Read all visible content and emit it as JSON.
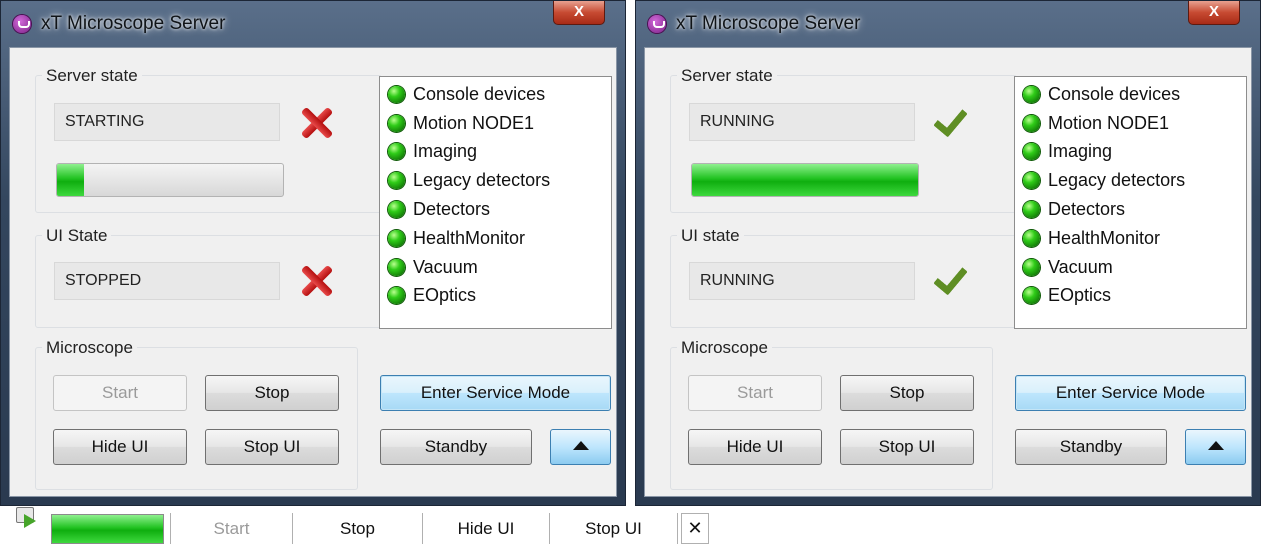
{
  "windows": [
    {
      "title": "xT Microscope Server",
      "close_glyph": "X",
      "server_state": {
        "label": "Server state",
        "value": "STARTING",
        "status_icon": "red-x-icon",
        "progress": 0.12
      },
      "ui_state": {
        "label": "UI State",
        "value": "STOPPED",
        "status_icon": "red-x-icon"
      },
      "modules": [
        "Console devices",
        "Motion NODE1",
        "Imaging",
        "Legacy detectors",
        "Detectors",
        "HealthMonitor",
        "Vacuum",
        "EOptics"
      ],
      "microscope": {
        "label": "Microscope",
        "start": "Start",
        "stop": "Stop",
        "hide_ui": "Hide UI",
        "stop_ui": "Stop UI"
      },
      "service_mode": "Enter Service Mode",
      "standby": "Standby"
    },
    {
      "title": "xT Microscope Server",
      "close_glyph": "X",
      "server_state": {
        "label": "Server state",
        "value": "RUNNING",
        "status_icon": "green-check-icon",
        "progress": 1.0
      },
      "ui_state": {
        "label": "UI state",
        "value": "RUNNING",
        "status_icon": "green-check-icon"
      },
      "modules": [
        "Console devices",
        "Motion NODE1",
        "Imaging",
        "Legacy detectors",
        "Detectors",
        "HealthMonitor",
        "Vacuum",
        "EOptics"
      ],
      "microscope": {
        "label": "Microscope",
        "start": "Start",
        "stop": "Stop",
        "hide_ui": "Hide UI",
        "stop_ui": "Stop UI"
      },
      "service_mode": "Enter Service Mode",
      "standby": "Standby"
    }
  ],
  "mini_toolbar": {
    "progress": 1.0,
    "start": "Start",
    "stop": "Stop",
    "hide_ui": "Hide UI",
    "stop_ui": "Stop UI",
    "close_glyph": "✕"
  },
  "colors": {
    "led_green": "#2fcc18",
    "progress_green": "#22c322",
    "error_red": "#c81a1a",
    "ok_green": "#5f8e24",
    "focus_blue": "#3c7fb1"
  }
}
